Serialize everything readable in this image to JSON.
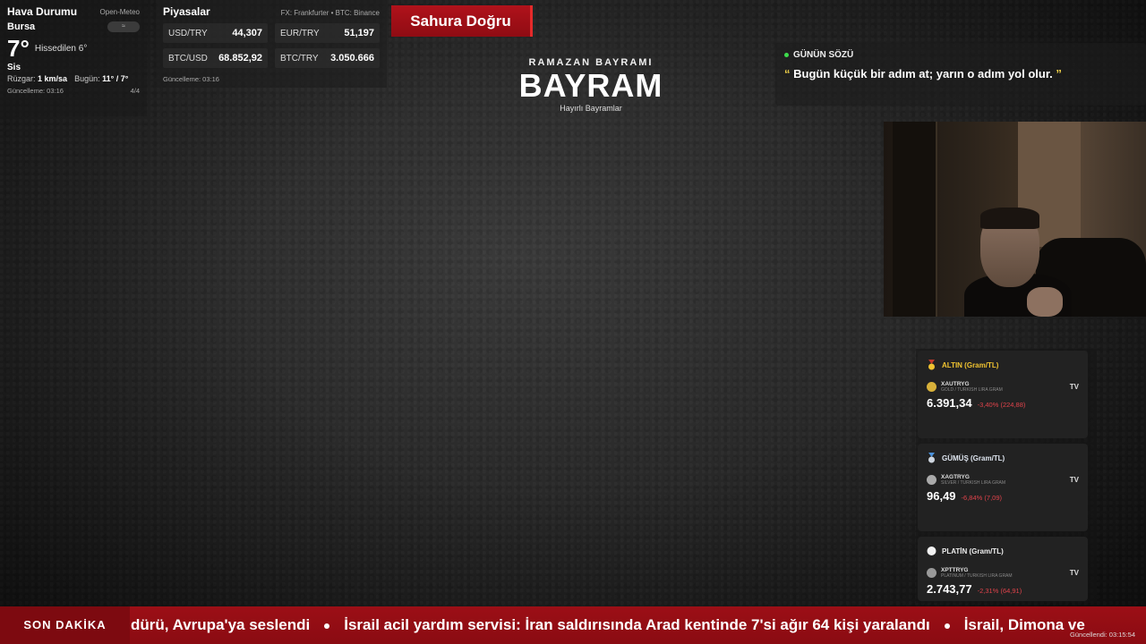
{
  "weather": {
    "title": "Hava Durumu",
    "source": "Open-Meteo",
    "city": "Bursa",
    "pill": "≈",
    "temp": "7°",
    "feels": "Hissedilen 6°",
    "condition": "Sis",
    "wind_label": "Rüzgar:",
    "wind_value": "1 km/sa",
    "today_label": "Bugün:",
    "today_value": "11° / 7°",
    "updated": "Güncelleme: 03:16",
    "page": "4/4"
  },
  "markets": {
    "title": "Piyasalar",
    "source": "FX: Frankfurter • BTC: Binance",
    "items": [
      {
        "symbol": "USD/TRY",
        "value": "44,307"
      },
      {
        "symbol": "EUR/TRY",
        "value": "51,197"
      },
      {
        "symbol": "BTC/USD",
        "value": "68.852,92"
      },
      {
        "symbol": "BTC/TRY",
        "value": "3.050.666"
      }
    ],
    "updated": "Güncelleme: 03:16"
  },
  "sahur": {
    "label": "Sahura Doğru"
  },
  "center": {
    "subtitle": "RAMAZAN BAYRAMI",
    "title": "BAYRAM",
    "tagline": "Hayırlı Bayramlar"
  },
  "quote": {
    "heading": "GÜNÜN SÖZÜ",
    "open_mark": "“",
    "text": "Bugün küçük bir adım at; yarın o adım yol olur.",
    "close_mark": "”"
  },
  "metals": [
    {
      "title": "ALTIN (Gram/TL)",
      "symbol": "XAUTRYG",
      "desc": "GOLD / TURKISH LIRA GRAM",
      "price": "6.391,34",
      "change": "-3,40% (224,88)",
      "tv": "TV"
    },
    {
      "title": "GÜMÜŞ (Gram/TL)",
      "symbol": "XAGTRYG",
      "desc": "SILVER / TURKISH LIRA GRAM",
      "price": "96,49",
      "change": "-6,84% (7,09)",
      "tv": "TV"
    },
    {
      "title": "PLATİN (Gram/TL)",
      "symbol": "XPTTRYG",
      "desc": "PLATINUM / TURKISH LIRA GRAM",
      "price": "2.743,77",
      "change": "-2,31% (64,91)",
      "tv": "TV"
    }
  ],
  "ticker": {
    "label": "SON DAKİKA",
    "items": [
      "dürü, Avrupa'ya seslendi",
      "İsrail acil yardım servisi: İran saldırısında Arad kentinde 7'si ağır 64 kişi yaralandı",
      "İsrail, Dimona ve"
    ],
    "updated": "Güncellendi: 03:15:54"
  },
  "colors": {
    "accent_red": "#9c0f16",
    "gold": "#f0c330",
    "negative": "#e0434b",
    "live_dot": "#3ddc4c"
  }
}
